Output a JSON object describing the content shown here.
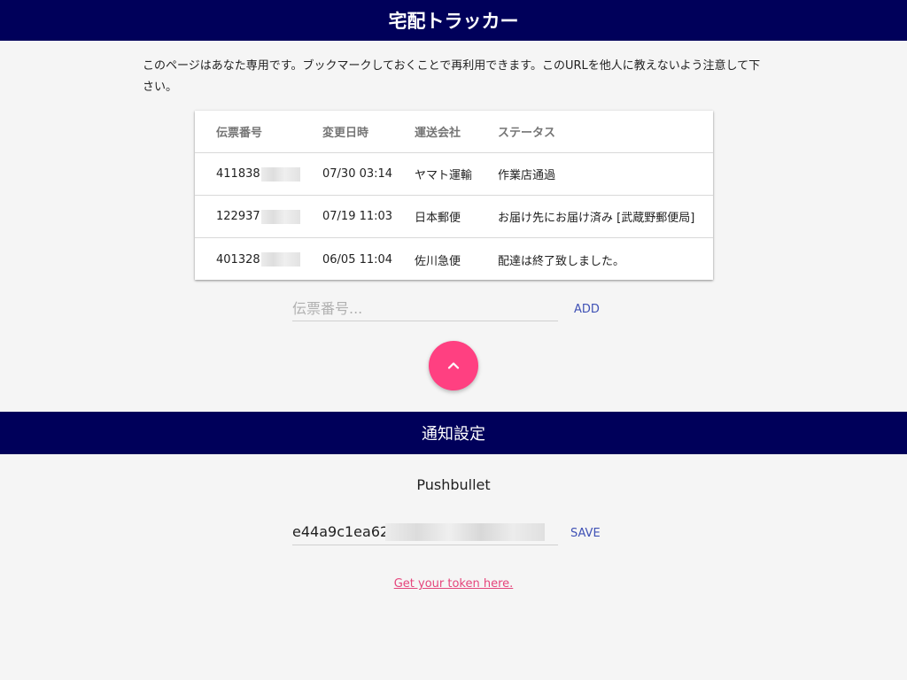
{
  "header": {
    "title": "宅配トラッカー"
  },
  "notice": "このページはあなた専用です。ブックマークしておくことで再利用できます。このURLを他人に教えないよう注意して下さい。",
  "table": {
    "columns": [
      "伝票番号",
      "変更日時",
      "運送会社",
      "ステータス"
    ],
    "rows": [
      {
        "number": "411838",
        "datetime": "07/30 03:14",
        "carrier": "ヤマト運輸",
        "status": "作業店通過"
      },
      {
        "number": "122937",
        "datetime": "07/19 11:03",
        "carrier": "日本郵便",
        "status": "お届け先にお届け済み [武蔵野郵便局]"
      },
      {
        "number": "401328",
        "datetime": "06/05 11:04",
        "carrier": "佐川急便",
        "status": "配達は終了致しました。"
      }
    ]
  },
  "add": {
    "placeholder": "伝票番号...",
    "button": "ADD"
  },
  "fab": {
    "icon": "chevron-up-icon"
  },
  "notifications": {
    "title": "通知設定",
    "service": "Pushbullet",
    "token_value": "e44a9c1ea62c",
    "save_button": "SAVE",
    "token_link": "Get your token here."
  },
  "colors": {
    "header": "#00005a",
    "accent": "#ff4081",
    "primary": "#3f51b5",
    "link": "#e5457c"
  }
}
